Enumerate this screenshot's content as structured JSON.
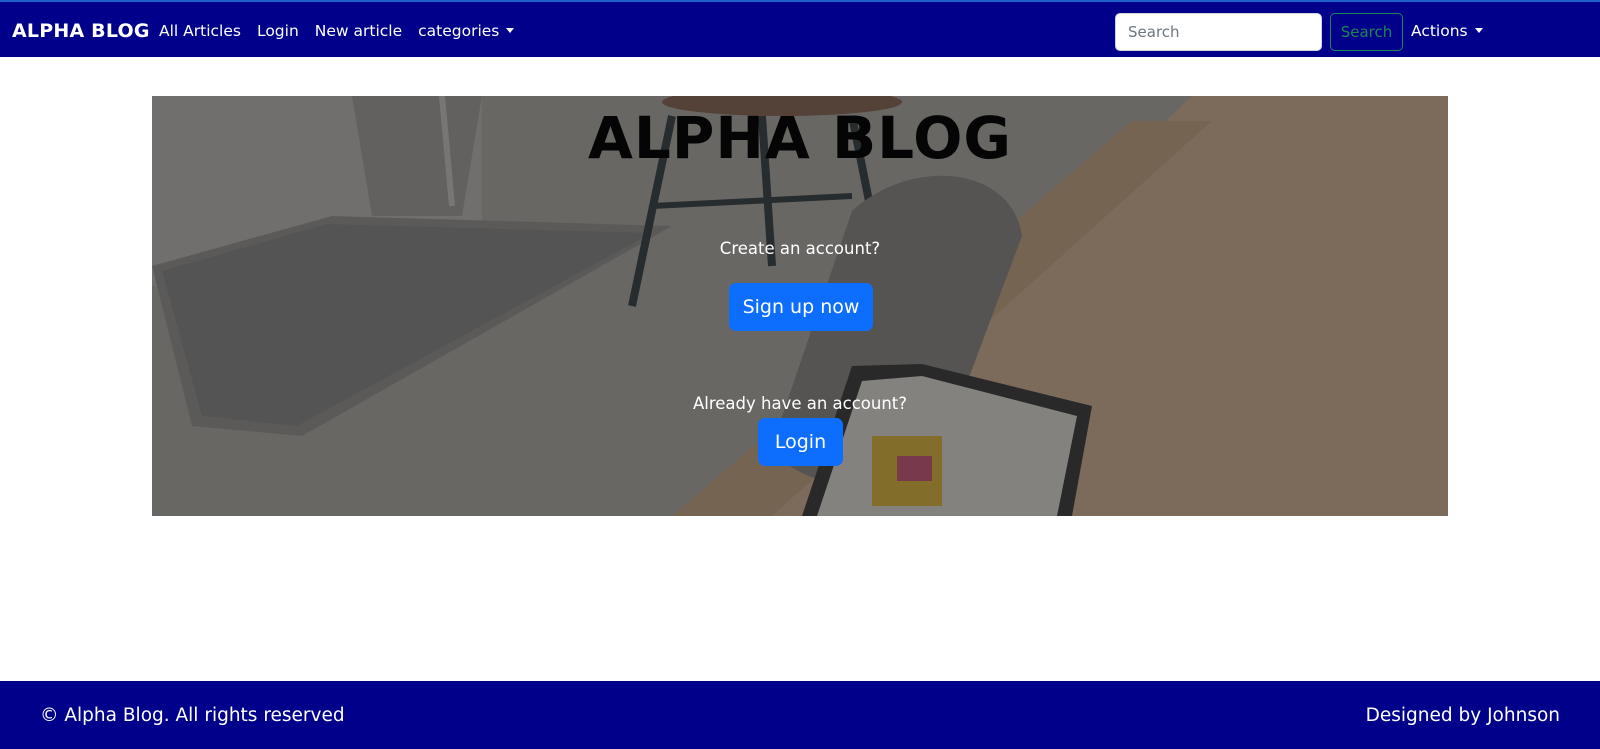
{
  "navbar": {
    "brand": "ALPHA BLOG",
    "links": [
      "All Articles",
      "Login",
      "New article",
      "categories"
    ],
    "search_placeholder": "Search",
    "search_button": "Search",
    "actions_label": "Actions"
  },
  "hero": {
    "title": "ALPHA BLOG",
    "create_prompt": "Create an account?",
    "signup_button": "Sign up now",
    "login_prompt": "Already have an account?",
    "login_button": "Login"
  },
  "footer": {
    "copyright": "© Alpha Blog. All rights reserved",
    "designed_by": "Designed by Johnson"
  },
  "colors": {
    "navbar_bg": "#00008b",
    "primary_button": "#0d6efd",
    "search_button": "#198754"
  }
}
